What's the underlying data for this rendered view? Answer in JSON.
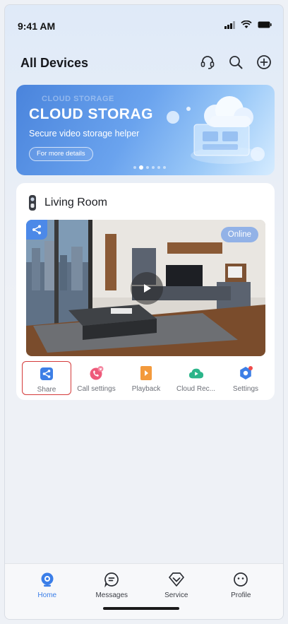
{
  "status_bar": {
    "time": "9:41 AM"
  },
  "header": {
    "title": "All Devices",
    "actions": [
      "headset-icon",
      "search-icon",
      "add-circle-icon"
    ]
  },
  "banner": {
    "ghost_text": "CLOUD STORAGE",
    "title": "CLOUD STORAG",
    "subtitle": "Secure video storage helper",
    "button_label": "For more details",
    "pages": 6,
    "active_page": 2
  },
  "device": {
    "name": "Living Room",
    "status": "Online",
    "actions": [
      {
        "label": "Share",
        "icon": "share-icon",
        "color": "#3d7fe6"
      },
      {
        "label": "Call settings",
        "icon": "phone-heart-icon",
        "color": "#ee5a7a"
      },
      {
        "label": "Playback",
        "icon": "playback-icon",
        "color": "#f39a3c"
      },
      {
        "label": "Cloud Rec...",
        "icon": "cloud-play-icon",
        "color": "#2bb58a"
      },
      {
        "label": "Settings",
        "icon": "gear-icon",
        "color": "#3d7fe6"
      }
    ]
  },
  "tabbar": {
    "tabs": [
      {
        "label": "Home",
        "icon": "home-camera-icon",
        "active": true
      },
      {
        "label": "Messages",
        "icon": "message-icon",
        "active": false
      },
      {
        "label": "Service",
        "icon": "diamond-icon",
        "active": false
      },
      {
        "label": "Profile",
        "icon": "smiley-icon",
        "active": false
      }
    ]
  },
  "colors": {
    "accent": "#3a7ee8",
    "highlight_border": "#d43a3a",
    "online_badge": "#82a8e8"
  }
}
